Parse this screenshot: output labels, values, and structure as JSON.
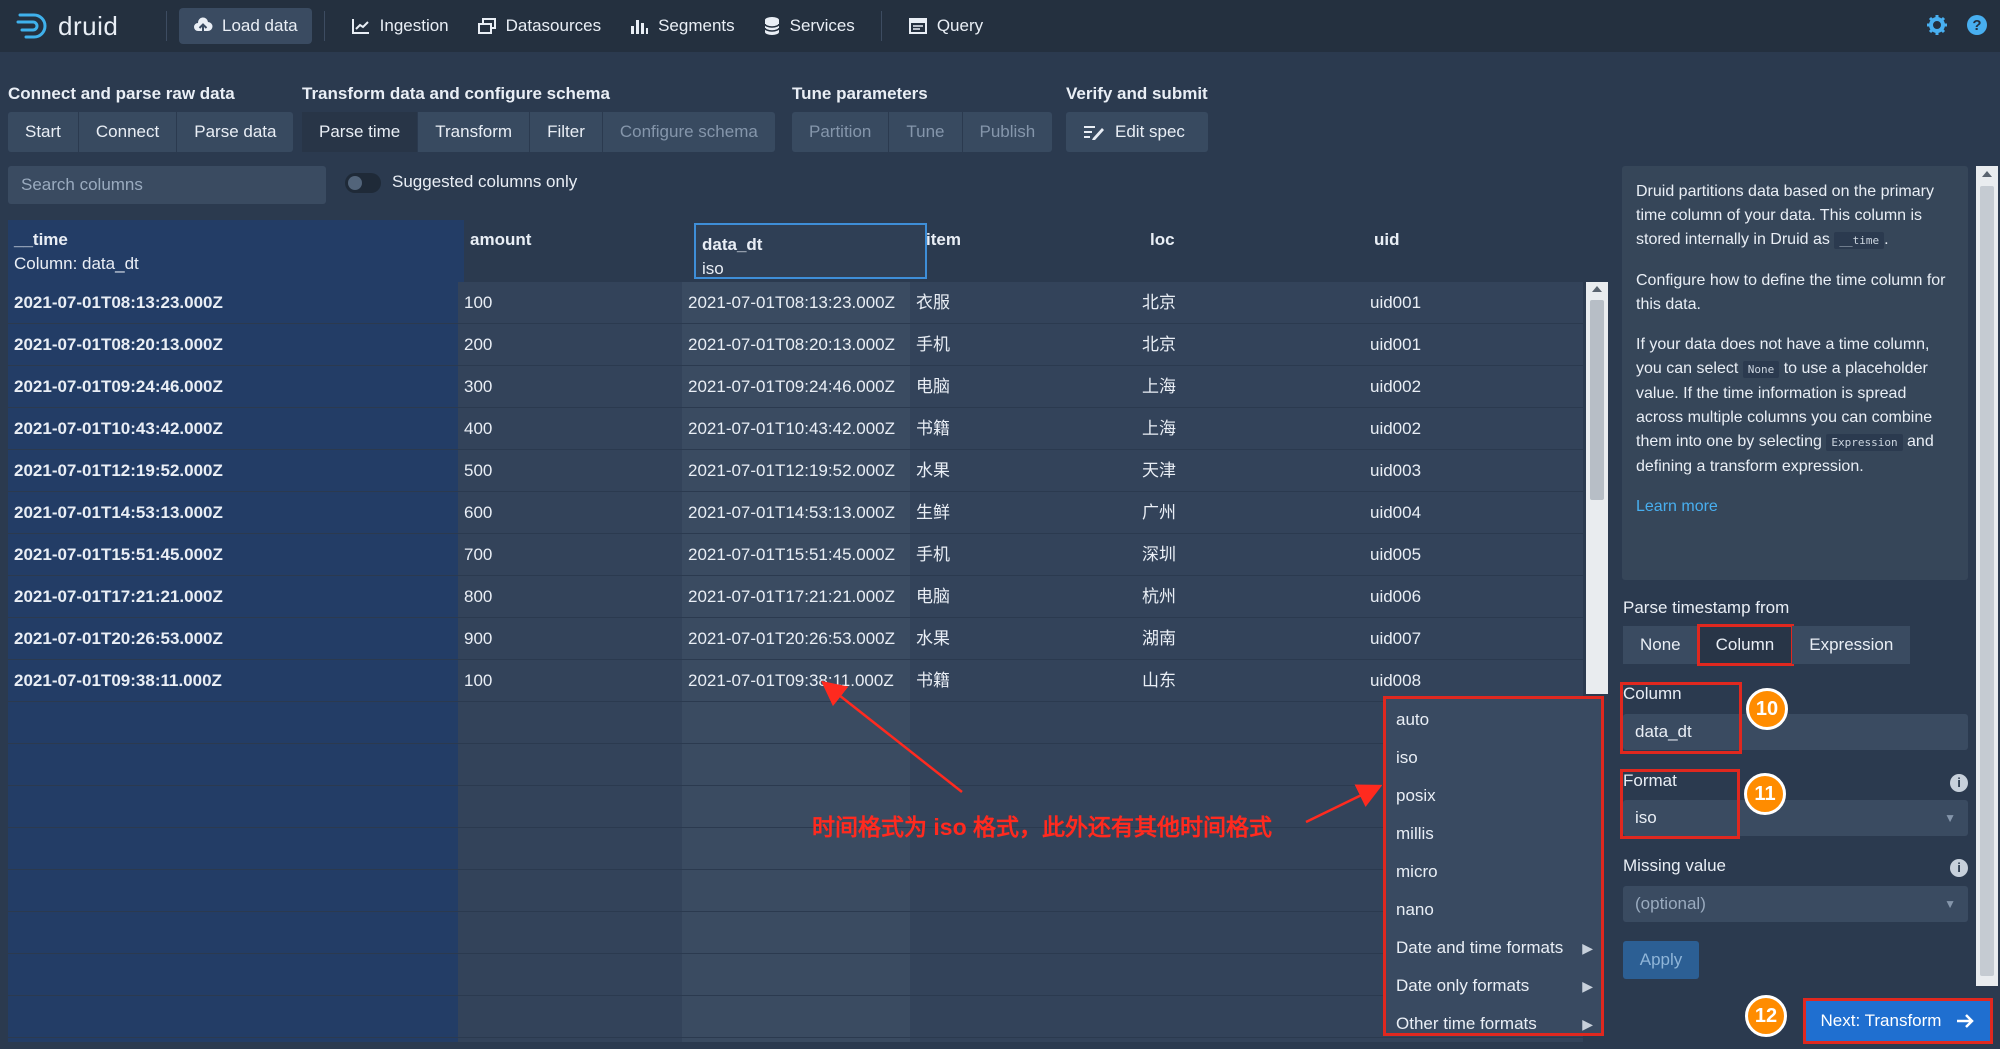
{
  "app": {
    "name": "druid"
  },
  "nav": {
    "items": [
      {
        "label": "Load data",
        "icon": "cloud-upload-icon",
        "active": true
      },
      {
        "label": "Ingestion",
        "icon": "chart-icon"
      },
      {
        "label": "Datasources",
        "icon": "layers-icon"
      },
      {
        "label": "Segments",
        "icon": "stacked-bars-icon"
      },
      {
        "label": "Services",
        "icon": "database-icon"
      },
      {
        "label": "Query",
        "icon": "application-icon"
      }
    ],
    "right_icons": [
      "gear-icon",
      "help-icon"
    ]
  },
  "steps": {
    "groups": [
      {
        "title": "Connect and parse raw data",
        "items": [
          "Start",
          "Connect",
          "Parse data"
        ]
      },
      {
        "title": "Transform data and configure schema",
        "items": [
          "Parse time",
          "Transform",
          "Filter",
          "Configure schema"
        ]
      },
      {
        "title": "Tune parameters",
        "items": [
          "Partition",
          "Tune",
          "Publish"
        ]
      },
      {
        "title": "Verify and submit",
        "items": [
          "Edit spec"
        ]
      }
    ],
    "active": "Parse time"
  },
  "search": {
    "placeholder": "Search columns"
  },
  "toggle": {
    "label": "Suggested columns only"
  },
  "table": {
    "columns": [
      {
        "name": "__time",
        "sub": "Column: data_dt"
      },
      {
        "name": "amount",
        "sub": ""
      },
      {
        "name": "data_dt",
        "sub": "iso"
      },
      {
        "name": "item",
        "sub": ""
      },
      {
        "name": "loc",
        "sub": ""
      },
      {
        "name": "uid",
        "sub": ""
      }
    ],
    "rows": [
      [
        "2021-07-01T08:13:23.000Z",
        "100",
        "2021-07-01T08:13:23.000Z",
        "衣服",
        "北京",
        "uid001"
      ],
      [
        "2021-07-01T08:20:13.000Z",
        "200",
        "2021-07-01T08:20:13.000Z",
        "手机",
        "北京",
        "uid001"
      ],
      [
        "2021-07-01T09:24:46.000Z",
        "300",
        "2021-07-01T09:24:46.000Z",
        "电脑",
        "上海",
        "uid002"
      ],
      [
        "2021-07-01T10:43:42.000Z",
        "400",
        "2021-07-01T10:43:42.000Z",
        "书籍",
        "上海",
        "uid002"
      ],
      [
        "2021-07-01T12:19:52.000Z",
        "500",
        "2021-07-01T12:19:52.000Z",
        "水果",
        "天津",
        "uid003"
      ],
      [
        "2021-07-01T14:53:13.000Z",
        "600",
        "2021-07-01T14:53:13.000Z",
        "生鲜",
        "广州",
        "uid004"
      ],
      [
        "2021-07-01T15:51:45.000Z",
        "700",
        "2021-07-01T15:51:45.000Z",
        "手机",
        "深圳",
        "uid005"
      ],
      [
        "2021-07-01T17:21:21.000Z",
        "800",
        "2021-07-01T17:21:21.000Z",
        "电脑",
        "杭州",
        "uid006"
      ],
      [
        "2021-07-01T20:26:53.000Z",
        "900",
        "2021-07-01T20:26:53.000Z",
        "水果",
        "湖南",
        "uid007"
      ],
      [
        "2021-07-01T09:38:11.000Z",
        "100",
        "2021-07-01T09:38:11.000Z",
        "书籍",
        "山东",
        "uid008"
      ]
    ]
  },
  "format_menu": {
    "items": [
      {
        "label": "auto",
        "submenu": false
      },
      {
        "label": "iso",
        "submenu": false
      },
      {
        "label": "posix",
        "submenu": false
      },
      {
        "label": "millis",
        "submenu": false
      },
      {
        "label": "micro",
        "submenu": false
      },
      {
        "label": "nano",
        "submenu": false
      },
      {
        "label": "Date and time formats",
        "submenu": true
      },
      {
        "label": "Date only formats",
        "submenu": true
      },
      {
        "label": "Other time formats",
        "submenu": true
      }
    ]
  },
  "annotation": {
    "text": "时间格式为 iso 格式，此外还有其他时间格式"
  },
  "panel": {
    "info": {
      "p1_a": "Druid partitions data based on the primary time column of your data. This column is stored internally in Druid as",
      "p1_code": "__time",
      "p1_b": ".",
      "p2": "Configure how to define the time column for this data.",
      "p3_a": "If your data does not have a time column, you can select",
      "p3_code1": "None",
      "p3_b": "to use a placeholder value. If the time information is spread across multiple columns you can combine them into one by selecting",
      "p3_code2": "Expression",
      "p3_c": "and defining a transform expression.",
      "learn_more": "Learn more"
    },
    "parse_label": "Parse timestamp from",
    "parse_options": [
      "None",
      "Column",
      "Expression"
    ],
    "parse_selected": "Column",
    "column_label": "Column",
    "column_value": "data_dt",
    "format_label": "Format",
    "format_value": "iso",
    "missing_label": "Missing value",
    "missing_placeholder": "(optional)",
    "apply_label": "Apply",
    "next_label": "Next: Transform"
  },
  "badges": [
    "10",
    "11",
    "12"
  ],
  "colors": {
    "accent_red": "#e0281f",
    "badge_orange": "#ff8c00",
    "primary_blue": "#1f6fd0",
    "time_col": "#233d66"
  }
}
